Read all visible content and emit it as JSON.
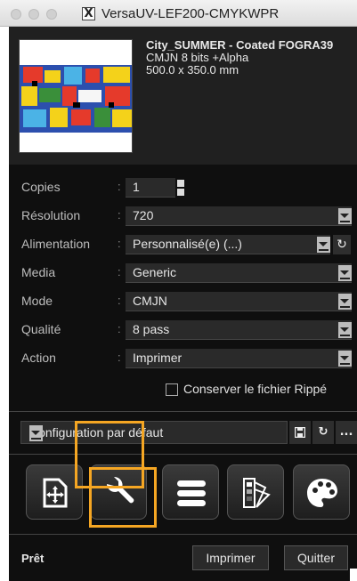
{
  "window": {
    "title": "VersaUV-LEF200-CMYKWPR"
  },
  "job": {
    "file_name": "City_SUMMER - Coated FOGRA39",
    "color_info": "CMJN 8 bits +Alpha",
    "dimensions": "500.0 x 350.0 mm"
  },
  "fields": {
    "copies": {
      "label": "Copies",
      "value": "1"
    },
    "resolution": {
      "label": "Résolution",
      "value": "720"
    },
    "feed": {
      "label": "Alimentation",
      "value": "Personnalisé(e) (...)"
    },
    "media": {
      "label": "Media",
      "value": "Generic"
    },
    "mode": {
      "label": "Mode",
      "value": "CMJN"
    },
    "quality": {
      "label": "Qualité",
      "value": "8 pass"
    },
    "action": {
      "label": "Action",
      "value": "Imprimer"
    }
  },
  "separator": ":",
  "keep_ripped": {
    "label": "Conserver le fichier Rippé",
    "checked": false
  },
  "configuration": {
    "value": "Configuration par défaut",
    "more_label": "..."
  },
  "toolbar": {
    "selected": "settings"
  },
  "highlight_color": "#f5a623",
  "footer": {
    "status": "Prêt",
    "print_label": "Imprimer",
    "quit_label": "Quitter"
  }
}
